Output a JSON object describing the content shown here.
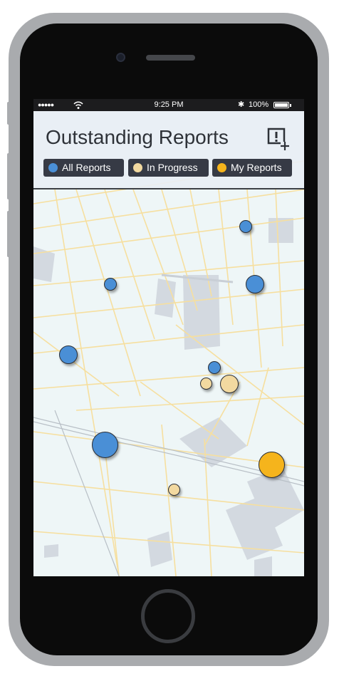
{
  "status_bar": {
    "signal": "●●●●●",
    "time": "9:25 PM",
    "bluetooth": "✱",
    "battery_percent": "100%"
  },
  "header": {
    "title": "Outstanding Reports",
    "add_report_icon": "report-add-icon"
  },
  "filters": [
    {
      "label": "All Reports",
      "color": "#4a8fd6"
    },
    {
      "label": "In Progress",
      "color": "#f2d9a0"
    },
    {
      "label": "My Reports",
      "color": "#f5b41c"
    }
  ],
  "colors": {
    "all_reports": "#4a8fd6",
    "in_progress": "#f2d9a0",
    "my_reports": "#f5b41c",
    "header_bg": "#e8eef4",
    "chip_bg": "#363a45",
    "map_road": "#f6df9f",
    "map_block": "#d3d9e0"
  },
  "map": {
    "markers": [
      {
        "status": "all_reports",
        "size": "small"
      },
      {
        "status": "all_reports",
        "size": "medium"
      },
      {
        "status": "all_reports",
        "size": "small"
      },
      {
        "status": "all_reports",
        "size": "medium"
      },
      {
        "status": "all_reports",
        "size": "small"
      },
      {
        "status": "in_progress",
        "size": "small"
      },
      {
        "status": "in_progress",
        "size": "medium"
      },
      {
        "status": "all_reports",
        "size": "large"
      },
      {
        "status": "my_reports",
        "size": "large"
      },
      {
        "status": "in_progress",
        "size": "small"
      }
    ]
  }
}
